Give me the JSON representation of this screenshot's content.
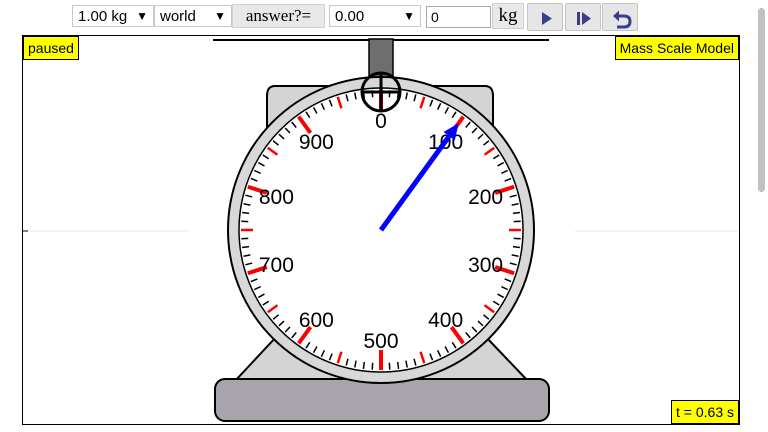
{
  "toolbar": {
    "mass_select": {
      "value": "1.00 kg"
    },
    "frame_select": {
      "value": "world"
    },
    "answer_label": "answer?=",
    "answer_select": {
      "value": "0.00"
    },
    "answer_input": {
      "value": "0"
    },
    "unit_label": "kg",
    "play_icon": "play-icon",
    "step_icon": "step-forward-icon",
    "reset_icon": "reset-icon"
  },
  "canvas": {
    "status_label": "paused",
    "model_label": "Mass Scale Model",
    "time_label": "t = 0.63 s"
  },
  "dial": {
    "labels": [
      "0",
      "100",
      "200",
      "300",
      "400",
      "500",
      "600",
      "700",
      "800",
      "900"
    ],
    "needle_reading": 100,
    "scale_max": 1000
  },
  "colors": {
    "highlight": "#ffff00",
    "needle": "#0000ff",
    "major_tick": "#ff0000",
    "scale_body": "#d4d4d4",
    "base": "#a8a4ac"
  }
}
